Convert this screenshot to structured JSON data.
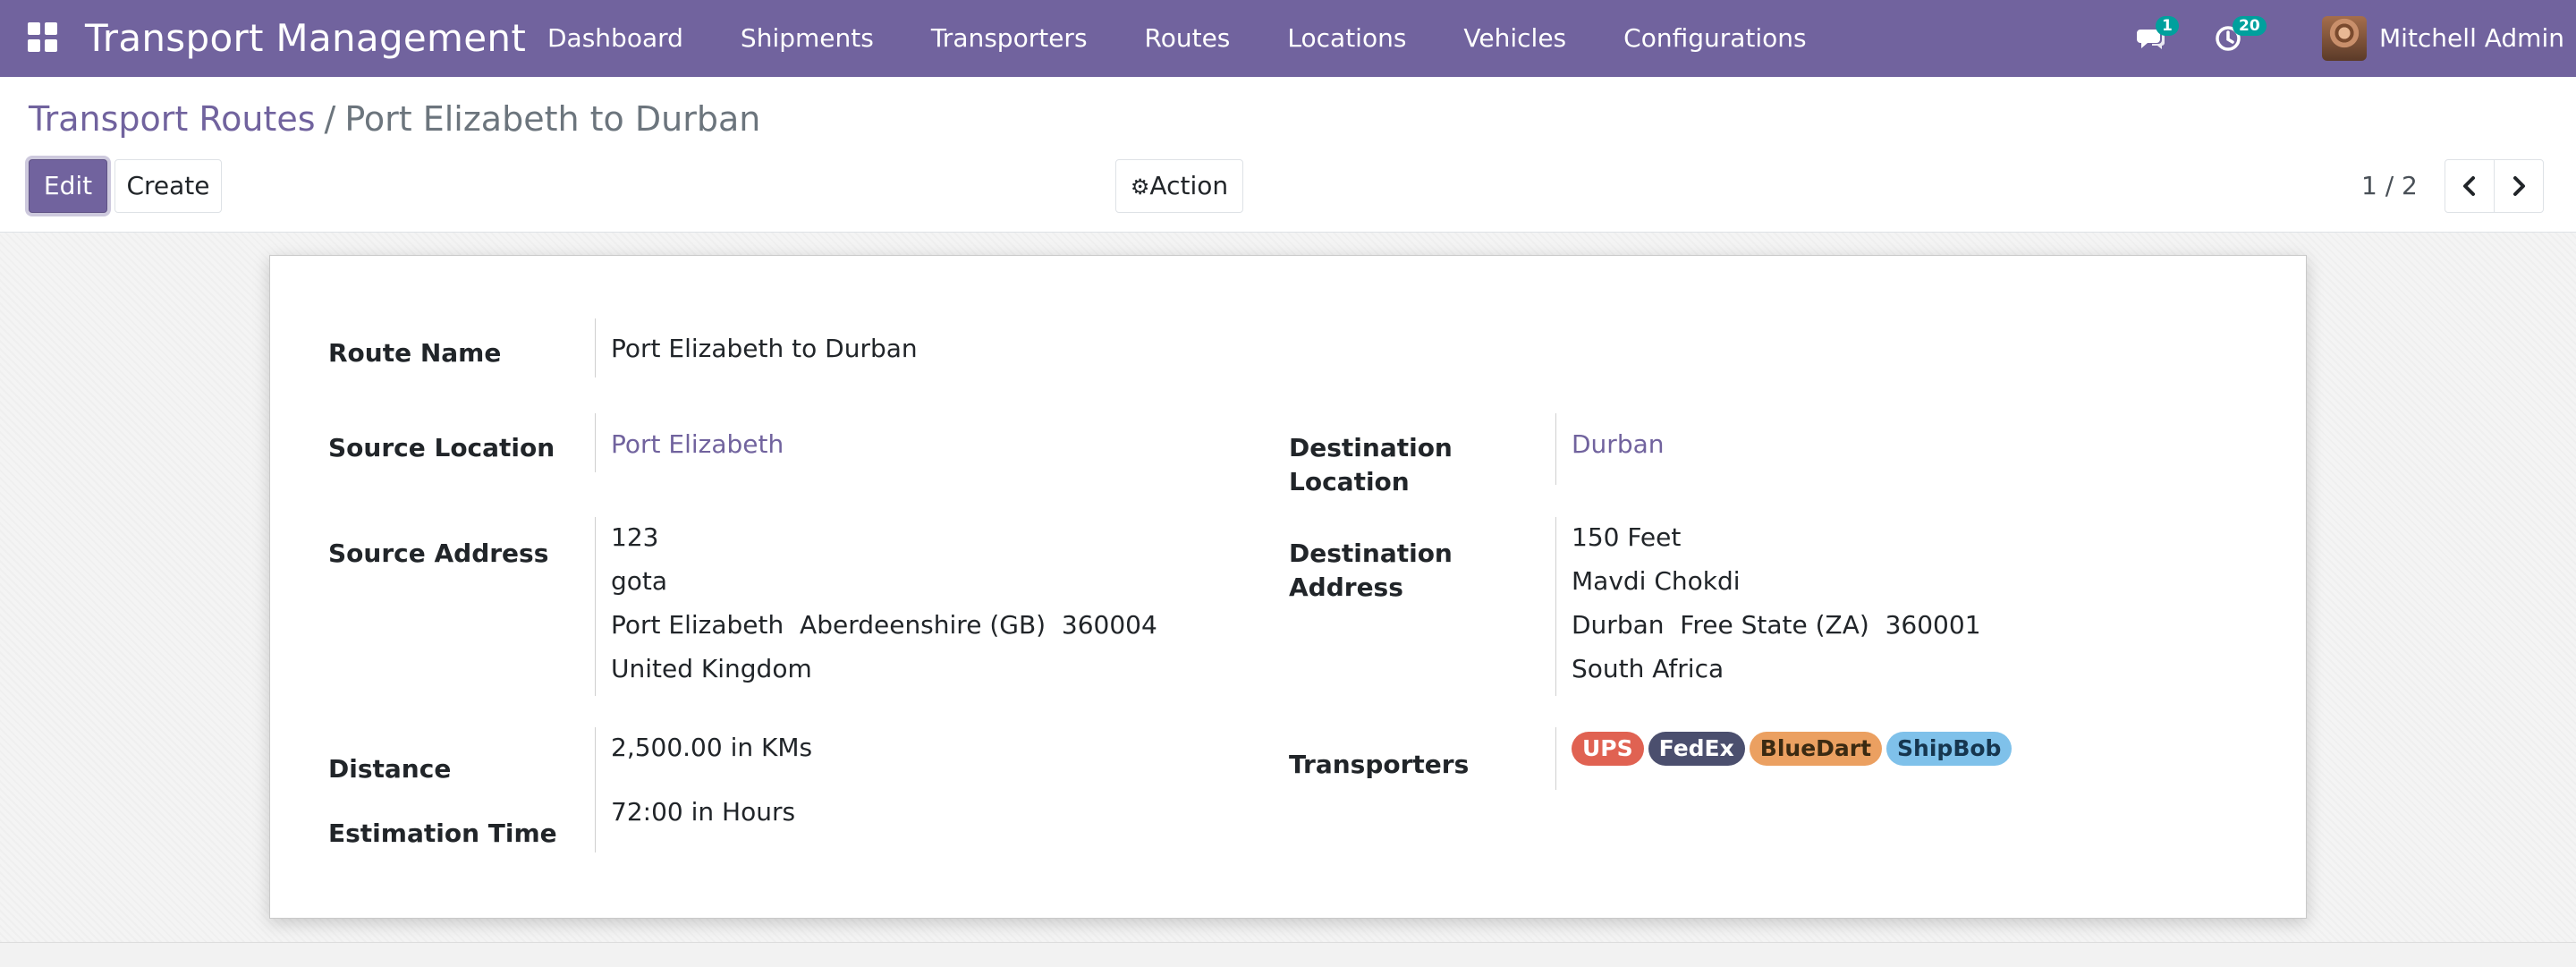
{
  "navbar": {
    "app_title": "Transport Management",
    "menu": [
      "Dashboard",
      "Shipments",
      "Transporters",
      "Routes",
      "Locations",
      "Vehicles",
      "Configurations"
    ],
    "messages_count": "1",
    "activities_count": "20",
    "user_name": "Mitchell Admin",
    "colors": {
      "navbar_bg": "#71639e",
      "badge_bg": "#00a09d"
    }
  },
  "breadcrumb": {
    "parent": "Transport Routes",
    "separator": "/",
    "current": "Port Elizabeth to Durban"
  },
  "buttons": {
    "edit": "Edit",
    "create": "Create",
    "action": "Action"
  },
  "pager": {
    "value": "1 / 2"
  },
  "form": {
    "route_name": {
      "label": "Route Name",
      "value": "Port Elizabeth to Durban"
    },
    "source_location": {
      "label": "Source Location",
      "value": "Port Elizabeth"
    },
    "destination_location": {
      "label_line1": "Destination",
      "label_line2": "Location",
      "value": "Durban"
    },
    "source_address": {
      "label": "Source Address",
      "lines": [
        "123",
        "gota",
        "Port Elizabeth  Aberdeenshire (GB)  360004",
        "United Kingdom"
      ]
    },
    "destination_address": {
      "label_line1": "Destination",
      "label_line2": "Address",
      "lines": [
        "150 Feet",
        "Mavdi Chokdi",
        "Durban  Free State (ZA)  360001",
        "South Africa"
      ]
    },
    "distance": {
      "label": "Distance",
      "value": "2,500.00 in KMs"
    },
    "estimation_time": {
      "label": "Estimation Time",
      "value": "72:00 in Hours"
    },
    "transporters": {
      "label": "Transporters",
      "tags": [
        {
          "name": "UPS",
          "bg": "#e06252",
          "fg": "#ffffff"
        },
        {
          "name": "FedEx",
          "bg": "#4b4f6e",
          "fg": "#ffffff"
        },
        {
          "name": "BlueDart",
          "bg": "#eba061",
          "fg": "#3b2a12"
        },
        {
          "name": "ShipBob",
          "bg": "#7fc1ea",
          "fg": "#16364f"
        }
      ]
    }
  }
}
